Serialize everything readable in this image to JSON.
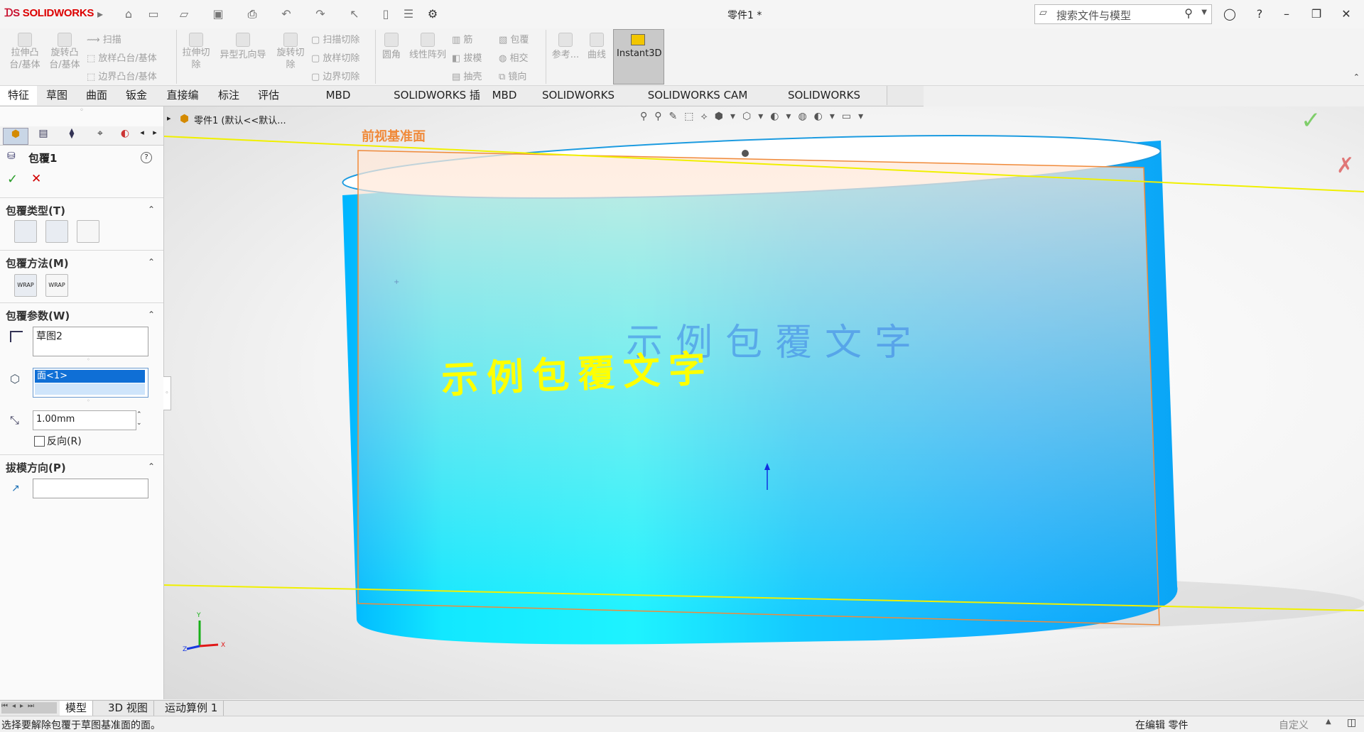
{
  "app": {
    "logo": "SOLIDWORKS",
    "doc_title": "零件1 *"
  },
  "search": {
    "placeholder": "搜索文件与模型"
  },
  "ribbon": {
    "extrude_boss": "拉伸凸\n台/基体",
    "revolve_boss": "旋转凸\n台/基体",
    "sweep": "扫描",
    "loft_boss": "放样凸台/基体",
    "boundary_boss": "边界凸台/基体",
    "extrude_cut": "拉伸切\n除",
    "hole_wizard": "异型孔向导",
    "revolve_cut": "旋转切\n除",
    "sweep_cut": "扫描切除",
    "loft_cut": "放样切除",
    "boundary_cut": "边界切除",
    "fillet": "圆角",
    "linear_pattern": "线性阵列",
    "rib": "筋",
    "draft": "拔模",
    "shell": "抽壳",
    "wrap": "包覆",
    "intersect": "相交",
    "mirror": "镜向",
    "reference": "参考...",
    "curves": "曲线",
    "instant3d": "Instant3D"
  },
  "tabs": [
    "特征",
    "草图",
    "曲面",
    "钣金",
    "直接编辑",
    "标注",
    "评估",
    "MBD Dimensions",
    "SOLIDWORKS 插件",
    "MBD",
    "SOLIDWORKS CAM",
    "SOLIDWORKS CAM TBM",
    "SOLIDWORKS Inspection"
  ],
  "tree": {
    "label": "零件1  (默认<<默认..."
  },
  "panel": {
    "feature_name": "包覆1",
    "wrap_type": "包覆类型(T)",
    "wrap_method": "包覆方法(M)",
    "wrap_params": "包覆参数(W)",
    "sketch_value": "草图2",
    "face_value": "面<1>",
    "thickness_value": "1.00mm",
    "reverse": "反向(R)",
    "draft_dir": "拔模方向(P)",
    "wrap_method_1": "WRAP",
    "wrap_method_2": "WRAP"
  },
  "viewport": {
    "plane_label": "前视基准面",
    "wrap_text_flat": "示例包覆文字",
    "wrap_text_wrapped": "示例包覆文字",
    "triad_x": "X",
    "triad_y": "Y",
    "triad_z": "Z"
  },
  "bottom_tabs": [
    "模型",
    "3D 视图",
    "运动算例 1"
  ],
  "status": {
    "message": "选择要解除包覆于草图基准面的面。",
    "mode": "在编辑 零件",
    "custom": "自定义"
  },
  "colors": {
    "cylinder": "#00c8ff",
    "plane": "#ff8c3a",
    "yellow_line": "#f0f000",
    "wrap_text": "#ffff00"
  }
}
